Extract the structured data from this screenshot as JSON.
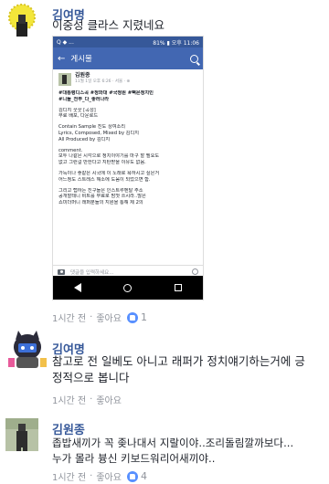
{
  "comments": [
    {
      "author": "김여명",
      "text_lines": [
        "이중성 클라스 지렸네요"
      ],
      "time": "1시간 전",
      "like_label": "좋아요",
      "reaction_count": "1",
      "dot": "·"
    },
    {
      "author": "김여명",
      "text_lines": [
        "참고로 전 일베도 아니고 래퍼가 정치얘기하는거에 긍",
        "정적으로 봅니다"
      ],
      "time": "1시간 전",
      "like_label": "좋아요",
      "dot": "·"
    },
    {
      "author": "김원종",
      "text_lines": [
        "좁밥새끼가 꼭 좆나대서 지랄이야..조리돌림깔까보다...",
        "누가 몰라 븅신 키보드워리어새끼야.."
      ],
      "time": "1시간 전",
      "like_label": "좋아요",
      "reaction_count": "4",
      "dot": "·"
    }
  ],
  "embedded_screenshot": {
    "status_left": "Q ◆ ...",
    "status_right": "81% ▮ 오후 11:06",
    "appbar_back": "←",
    "appbar_title": "게시물",
    "post_author": "김원종",
    "post_time": "11월 1일 오후 6:26 · 서울 · ⊕",
    "tags": [
      "#대통령디스곡 #정와대 #국정원 #뻑은정치인",
      "#니들_전부_다_좋러나라"
    ],
    "lines_a": [
      "김디지 꿋꿋 [곡성]",
      "무료 배포, 다운로드"
    ],
    "lines_b": [
      "Contain Sample 진도 상여소리",
      "Lyrics, Composed, Mixed by 김디지",
      "All Produced by 김디지"
    ],
    "lines_c": [
      "comment.",
      "모두 나같은 시각으로 정치이야기를 마구 할 필요도",
      "없고 그런걸 만한다고 지탄받을 이유도 없음."
    ],
    "lines_d": [
      "가득이나 좋같은 시국에 이 노래로 욕하시고 싶은거",
      "어느정도 스트레스 해소에 도움이 되었으면 함."
    ],
    "lines_e": [
      "그리고 랩하는 친구들은 인스트루멘탈 주소",
      "공개할테니 비트를 무료로 맘껏 쓰시라..많은",
      "쇼미더머니 래퍼분들의 지원을 통해 제 2의"
    ],
    "comment_placeholder": "댓글을 입력하세요..."
  }
}
